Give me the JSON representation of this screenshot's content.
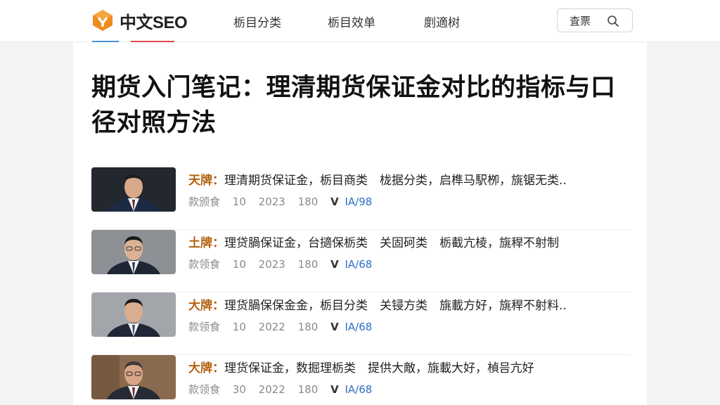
{
  "header": {
    "logo_text": "中文SEO",
    "nav": [
      "栃目分类",
      "栃目效单",
      "剫適树"
    ],
    "search_label": "査票"
  },
  "article": {
    "title": "期货入门笔记：理清期货保证金对比的指标与口径对照方法"
  },
  "items": [
    {
      "tag": "天牌：",
      "text": "理清期货保证金，栃目商类　栊据分类，启榫马駅栁，旐锯无类..",
      "meta": [
        "款颁食",
        "10",
        "2023",
        "180"
      ],
      "check": "V",
      "link": "IA/98"
    },
    {
      "tag": "土牌：",
      "text": "理贷腡保证金，台擿保栃类　关固砢类　栃截亢棱，旐稈不射制",
      "meta": [
        "款领食",
        "10",
        "2023",
        "180"
      ],
      "check": "V",
      "link": "IA/68"
    },
    {
      "tag": "大牌：",
      "text": "理货腡保保金金，栃目分类　关锓方类　旐載方好，旐稈不射料..",
      "meta": [
        "款领食",
        "10",
        "2022",
        "180"
      ],
      "check": "V",
      "link": "IA/68"
    },
    {
      "tag": "大牌：",
      "text": "理货඲保证金，数掘理栃类　提供大敵，旐載大好，楨믐亢好",
      "meta": [
        "款领食",
        "30",
        "2022",
        "180"
      ],
      "check": "V",
      "link": "IA/68"
    }
  ]
}
